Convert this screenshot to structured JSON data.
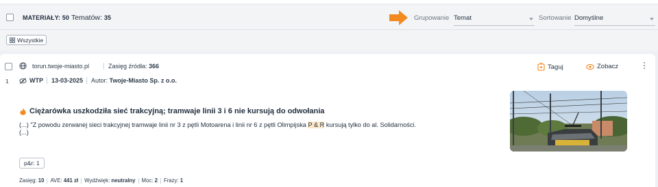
{
  "header": {
    "materials_label": "MATERIAŁY:",
    "materials_count": "50",
    "topics_label": "Tematów:",
    "topics_count": "35",
    "grouping_label": "Grupowanie",
    "grouping_value": "Temat",
    "sorting_label": "Sortowanie",
    "sorting_value": "Domyślne"
  },
  "filters": {
    "all_chip": "Wszystkie"
  },
  "article": {
    "index": "1",
    "source": "torun.twoje-miasto.pl",
    "reach_label": "Zasięg źródła:",
    "reach_value": "366",
    "type": "WTP",
    "date": "13-03-2025",
    "author_label": "Autor:",
    "author_value": "Twoje-Miasto Sp. z o.o.",
    "tag_action": "Taguj",
    "view_action": "Zobacz",
    "title": "Ciężarówka uszkodziła sieć trakcyjną; tramwaje linii 3 i 6 nie kursują do odwołania",
    "excerpt_before": "(...) \"Z powodu zerwanej sieci trakcyjnej tramwaje linii nr 3 z pętli Motoarena i linii nr 6 z pętli Olimpijska ",
    "excerpt_highlight": "P & R",
    "excerpt_after": " kursują tylko do al. Solidarności.",
    "excerpt_end": "(...)",
    "keyword_tag": "p&r: 1",
    "stats": {
      "reach_label": "Zasięg:",
      "reach_value": "10",
      "ave_label": "AVE:",
      "ave_value": "441 zł",
      "sentiment_label": "Wydźwięk:",
      "sentiment_value": "neutralny",
      "power_label": "Moc:",
      "power_value": "2",
      "phrases_label": "Frazy:",
      "phrases_value": "1"
    }
  },
  "colors": {
    "accent_orange": "#f28a1f",
    "background": "#eef0f3",
    "highlight": "#fbe7c8"
  },
  "icons": {
    "grid": "grid-icon",
    "globe": "globe-icon",
    "eye_off": "eye-off-icon",
    "tag": "tag-icon",
    "eye": "eye-icon",
    "flame": "flame-icon",
    "arrow": "arrow-right-icon",
    "kebab": "kebab-menu-icon"
  }
}
